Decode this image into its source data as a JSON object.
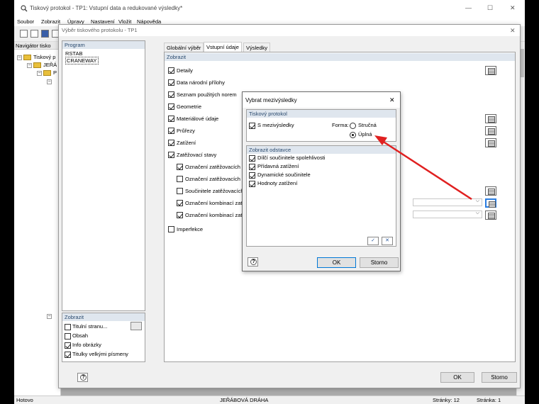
{
  "window": {
    "title": "Tiskový protokol - TP1: Vstupní data a redukované výsledky*",
    "minimize": "—",
    "maximize": "☐",
    "close": "✕"
  },
  "menu": [
    "Soubor",
    "Zobrazit",
    "Úpravy",
    "Nastavení",
    "Vložit",
    "Nápověda"
  ],
  "navigator": {
    "title": "Navigátor tisko",
    "root": "Tiskový p",
    "child1": "JEŘÁ",
    "child2": "P"
  },
  "main_dialog": {
    "title": "Výběr tiskového protokolu - TP1",
    "close": "✕",
    "program_header": "Program",
    "programs": [
      "RSTAB",
      "CRANEWAY"
    ],
    "zobrazit_header": "Zobrazit",
    "bottom_options": [
      {
        "label": "Titulní stranu...",
        "checked": false
      },
      {
        "label": "Obsah",
        "checked": false
      },
      {
        "label": "Info obrázky",
        "checked": true
      },
      {
        "label": "Titulky velkými písmeny",
        "checked": true
      }
    ],
    "tabs": [
      "Globální výběr",
      "Vstupní údaje",
      "Výsledky"
    ],
    "active_tab": "Vstupní údaje",
    "section_header": "Zobrazit",
    "items": [
      {
        "label": "Detaily",
        "checked": true
      },
      {
        "label": "Data národní přílohy",
        "checked": true
      },
      {
        "label": "Seznam použitých norem",
        "checked": true
      },
      {
        "label": "Geometrie",
        "checked": true
      },
      {
        "label": "Materiálové údaje",
        "checked": true
      },
      {
        "label": "Průřezy",
        "checked": true
      },
      {
        "label": "Zatížení",
        "checked": true
      },
      {
        "label": "Zatěžovací stavy",
        "checked": true
      },
      {
        "label": "Označení zatěžovacích stavů",
        "checked": true
      },
      {
        "label": "Označení zatěžovacích stavů",
        "checked": false
      },
      {
        "label": "Součinitele zatěžovacích stavů",
        "checked": false
      },
      {
        "label": "Označení kombinací zatížení",
        "checked": true
      },
      {
        "label": "Označení kombinací zatížení",
        "checked": true
      },
      {
        "label": "Imperfekce",
        "checked": false
      }
    ],
    "ok": "OK",
    "cancel": "Storno"
  },
  "sub_dialog": {
    "title": "Vybrat mezivýsledky",
    "close": "✕",
    "protocol_header": "Tiskový protokol",
    "with_intermediate": "S mezivýsledky",
    "form_label": "Forma:",
    "options": [
      "Stručná",
      "Úplná"
    ],
    "selected_option": "Úplná",
    "sections_header": "Zobrazit odstavce",
    "sections": [
      {
        "label": "Dílčí součinitele spolehlivosti",
        "checked": true
      },
      {
        "label": "Přídavná zatížení",
        "checked": true
      },
      {
        "label": "Dynamické součinitele",
        "checked": true
      },
      {
        "label": "Hodnoty zatížení",
        "checked": true
      }
    ],
    "ok": "OK",
    "cancel": "Storno"
  },
  "status": {
    "left": "Hotovo",
    "center": "JEŘÁBOVÁ DRÁHA",
    "pages": "Stránky: 12",
    "page": "Stránka: 1"
  },
  "colors": {
    "arrow": "#e02020",
    "selection": "#2a7de1",
    "header_bg": "#dfe6ee"
  }
}
